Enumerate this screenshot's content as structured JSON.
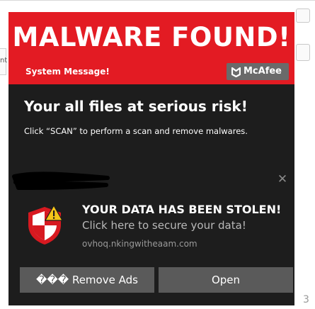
{
  "background": {
    "left_fragment": "nt",
    "bottom_fragment": "3"
  },
  "scam_popup": {
    "headline": "MALWARE FOUND!",
    "system_label": "System Message!",
    "brand": "McAfee",
    "risk_title": "Your all files at serious risk!",
    "risk_description": "Click “SCAN” to perform a scan and remove malwares.",
    "colors": {
      "banner": "#e31b23",
      "panel": "#1d1d1d",
      "brand_badge": "#6a6a6a"
    }
  },
  "notification": {
    "close_symbol": "✕",
    "icon": "shield-warning-icon",
    "title": "YOUR DATA HAS BEEN STOLEN!",
    "body": "Click here to secure your data!",
    "domain": "ovhoq.nkingwitheaam.com",
    "buttons": {
      "remove_ads": "��� Remove Ads",
      "open": "Open"
    },
    "colors": {
      "shield": "#d71920",
      "warning": "#f5c518",
      "button": "#5a5a5a"
    }
  }
}
